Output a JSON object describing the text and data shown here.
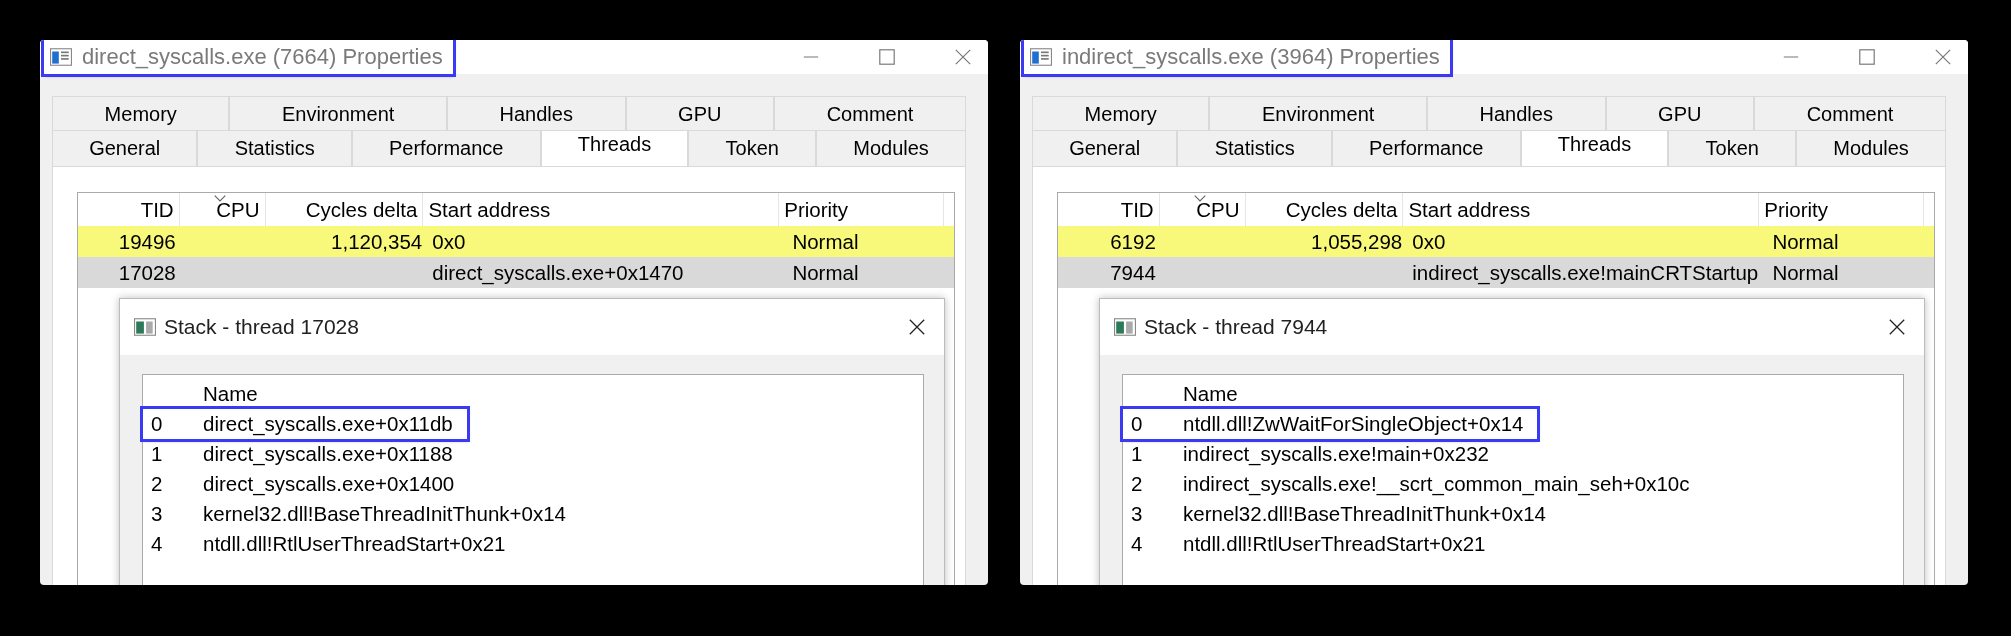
{
  "windows": [
    {
      "title": "direct_syscalls.exe (7664) Properties",
      "title_highlighted": true,
      "tab_rows": [
        [
          {
            "label": "Memory",
            "selected": false
          },
          {
            "label": "Environment",
            "selected": false
          },
          {
            "label": "Handles",
            "selected": false
          },
          {
            "label": "GPU",
            "selected": false
          },
          {
            "label": "Comment",
            "selected": false
          }
        ],
        [
          {
            "label": "General",
            "selected": false
          },
          {
            "label": "Statistics",
            "selected": false
          },
          {
            "label": "Performance",
            "selected": false
          },
          {
            "label": "Threads",
            "selected": true
          },
          {
            "label": "Token",
            "selected": false
          },
          {
            "label": "Modules",
            "selected": false
          }
        ]
      ],
      "threads": {
        "columns": [
          {
            "label": "TID",
            "sorted": false
          },
          {
            "label": "CPU",
            "sorted": true
          },
          {
            "label": "Cycles delta",
            "sorted": false
          },
          {
            "label": "Start address",
            "sorted": false
          },
          {
            "label": "Priority",
            "sorted": false
          }
        ],
        "rows": [
          {
            "tid": "19496",
            "cycles_delta": "1,120,354",
            "start_address": "0x0",
            "priority": "Normal",
            "color": "#f8f87a"
          },
          {
            "tid": "17028",
            "cycles_delta": "",
            "start_address": "direct_syscalls.exe+0x1470",
            "priority": "Normal",
            "color": "#d9d9d9"
          }
        ]
      },
      "stack": {
        "title": "Stack - thread 17028",
        "column": "Name",
        "frames": [
          {
            "index": "0",
            "name": "direct_syscalls.exe+0x11db",
            "highlighted": true
          },
          {
            "index": "1",
            "name": "direct_syscalls.exe+0x1188",
            "highlighted": false
          },
          {
            "index": "2",
            "name": "direct_syscalls.exe+0x1400",
            "highlighted": false
          },
          {
            "index": "3",
            "name": "kernel32.dll!BaseThreadInitThunk+0x14",
            "highlighted": false
          },
          {
            "index": "4",
            "name": "ntdll.dll!RtlUserThreadStart+0x21",
            "highlighted": false
          }
        ]
      }
    },
    {
      "title": "indirect_syscalls.exe (3964) Properties",
      "title_highlighted": true,
      "tab_rows": [
        [
          {
            "label": "Memory",
            "selected": false
          },
          {
            "label": "Environment",
            "selected": false
          },
          {
            "label": "Handles",
            "selected": false
          },
          {
            "label": "GPU",
            "selected": false
          },
          {
            "label": "Comment",
            "selected": false
          }
        ],
        [
          {
            "label": "General",
            "selected": false
          },
          {
            "label": "Statistics",
            "selected": false
          },
          {
            "label": "Performance",
            "selected": false
          },
          {
            "label": "Threads",
            "selected": true
          },
          {
            "label": "Token",
            "selected": false
          },
          {
            "label": "Modules",
            "selected": false
          }
        ]
      ],
      "threads": {
        "columns": [
          {
            "label": "TID",
            "sorted": false
          },
          {
            "label": "CPU",
            "sorted": true
          },
          {
            "label": "Cycles delta",
            "sorted": false
          },
          {
            "label": "Start address",
            "sorted": false
          },
          {
            "label": "Priority",
            "sorted": false
          }
        ],
        "rows": [
          {
            "tid": "6192",
            "cycles_delta": "1,055,298",
            "start_address": "0x0",
            "priority": "Normal",
            "color": "#f8f87a"
          },
          {
            "tid": "7944",
            "cycles_delta": "",
            "start_address": "indirect_syscalls.exe!mainCRTStartup",
            "priority": "Normal",
            "color": "#d9d9d9"
          }
        ]
      },
      "stack": {
        "title": "Stack - thread 7944",
        "column": "Name",
        "frames": [
          {
            "index": "0",
            "name": "ntdll.dll!ZwWaitForSingleObject+0x14",
            "highlighted": true
          },
          {
            "index": "1",
            "name": "indirect_syscalls.exe!main+0x232",
            "highlighted": false
          },
          {
            "index": "2",
            "name": "indirect_syscalls.exe!__scrt_common_main_seh+0x10c",
            "highlighted": false
          },
          {
            "index": "3",
            "name": "kernel32.dll!BaseThreadInitThunk+0x14",
            "highlighted": false
          },
          {
            "index": "4",
            "name": "ntdll.dll!RtlUserThreadStart+0x21",
            "highlighted": false
          }
        ]
      }
    }
  ]
}
